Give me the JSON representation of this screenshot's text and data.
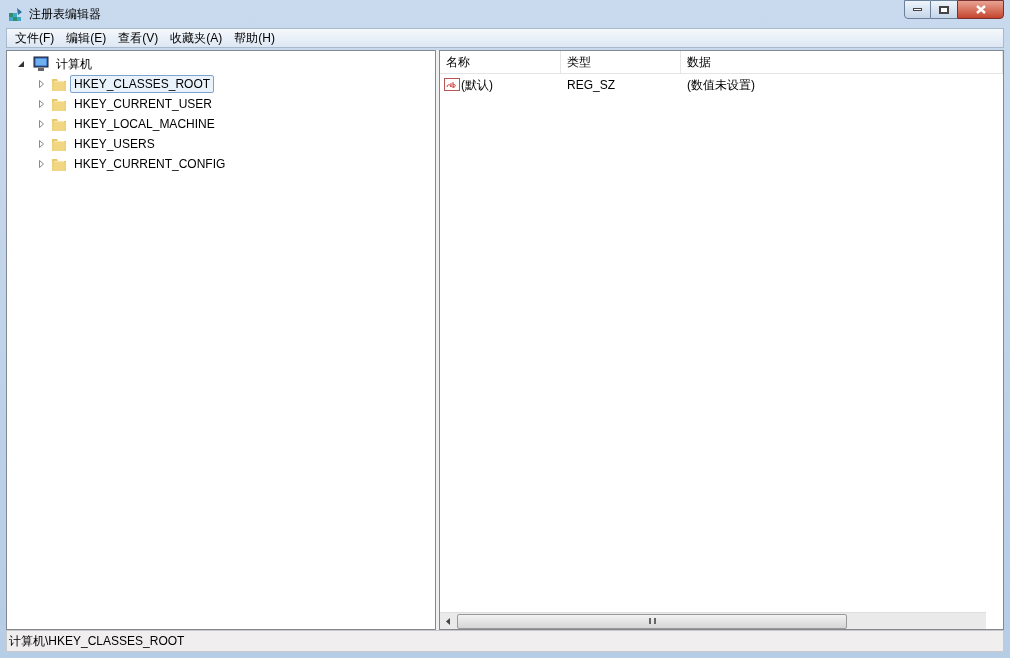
{
  "window": {
    "title": "注册表编辑器"
  },
  "menu": [
    "文件(F)",
    "编辑(E)",
    "查看(V)",
    "收藏夹(A)",
    "帮助(H)"
  ],
  "tree": [
    {
      "label": "计算机",
      "kind": "computer",
      "expanded": true,
      "selected": false,
      "children": [
        {
          "label": "HKEY_CLASSES_ROOT",
          "kind": "folder",
          "expanded": false,
          "selected": true
        },
        {
          "label": "HKEY_CURRENT_USER",
          "kind": "folder",
          "expanded": false,
          "selected": false
        },
        {
          "label": "HKEY_LOCAL_MACHINE",
          "kind": "folder",
          "expanded": false,
          "selected": false
        },
        {
          "label": "HKEY_USERS",
          "kind": "folder",
          "expanded": false,
          "selected": false
        },
        {
          "label": "HKEY_CURRENT_CONFIG",
          "kind": "folder",
          "expanded": false,
          "selected": false
        }
      ]
    }
  ],
  "table": {
    "columns": [
      "名称",
      "类型",
      "数据"
    ],
    "rows": [
      {
        "name": "(默认)",
        "type": "REG_SZ",
        "data": "(数值未设置)"
      }
    ]
  },
  "status_bar": "计算机\\HKEY_CLASSES_ROOT"
}
